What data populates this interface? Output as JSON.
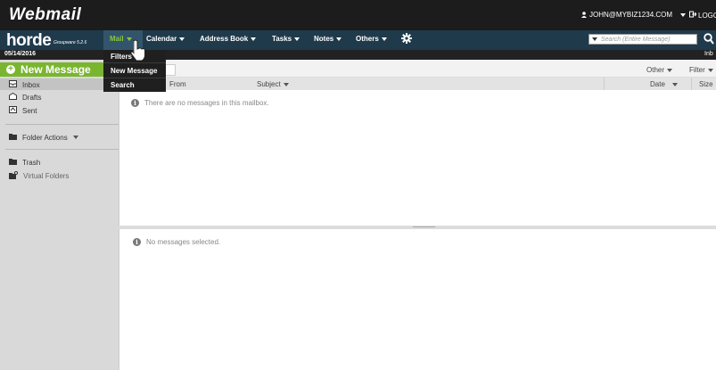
{
  "header": {
    "brand": "Webmail",
    "user": "JOHN@MYBIZ1234.COM",
    "logout": "LOGO"
  },
  "nav": {
    "logo": "horde",
    "logo_sub": "Groupware 5.2.6",
    "items": [
      {
        "label": "Mail"
      },
      {
        "label": "Calendar"
      },
      {
        "label": "Address Book"
      },
      {
        "label": "Tasks"
      },
      {
        "label": "Notes"
      },
      {
        "label": "Others"
      }
    ],
    "settings_icon": "gear-icon",
    "search_placeholder": "Search (Entire Message)"
  },
  "date": "05/14/2016",
  "inbox_short": "Inb",
  "dropdown": {
    "items": [
      {
        "label": "Filters"
      },
      {
        "label": "New Message"
      },
      {
        "label": "Search"
      }
    ]
  },
  "sidebar": {
    "new_message": "New Message",
    "folders": [
      {
        "label": "Inbox",
        "icon": "inbox-icon"
      },
      {
        "label": "Drafts",
        "icon": "drafts-icon"
      },
      {
        "label": "Sent",
        "icon": "sent-icon"
      }
    ],
    "folder_actions": "Folder Actions",
    "other_folders": [
      {
        "label": "Trash",
        "icon": "trash-icon"
      },
      {
        "label": "Virtual Folders",
        "icon": "virtual-folder-icon"
      }
    ]
  },
  "listbar": {
    "other": "Other",
    "filter": "Filter"
  },
  "columns": {
    "from": "From",
    "subject": "Subject",
    "date": "Date",
    "size": "Size"
  },
  "messages": {
    "empty": "There are no messages in this mailbox.",
    "none_selected": "No messages selected."
  },
  "colors": {
    "accent": "#7ab530",
    "navbar": "#1f3a4b",
    "topbar": "#1c1c1c"
  }
}
